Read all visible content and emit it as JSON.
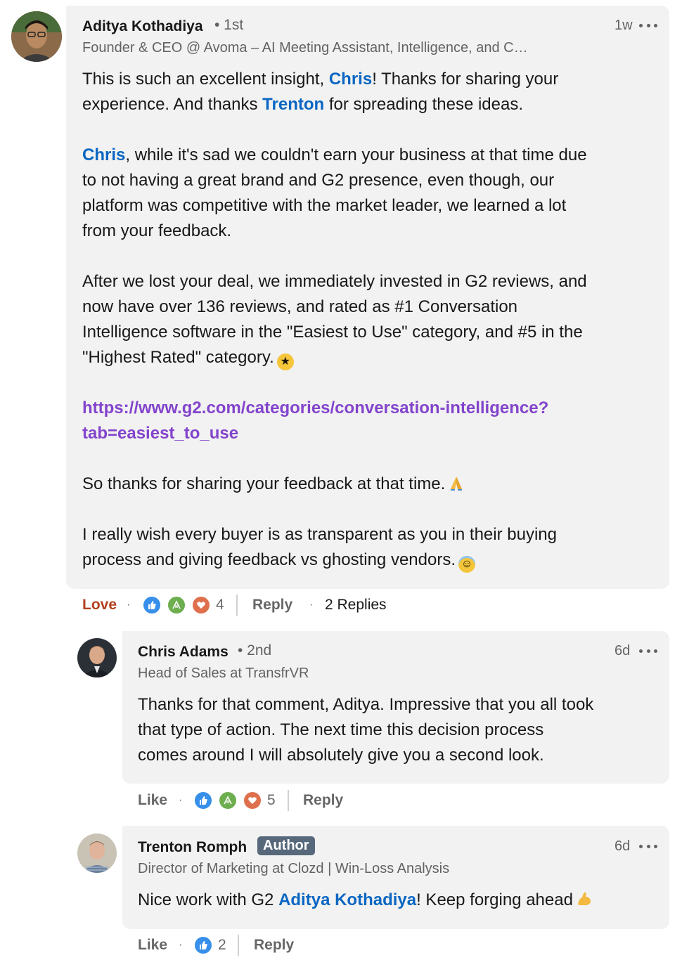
{
  "comments": [
    {
      "author": "Aditya Kothadiya",
      "degree": "• 1st",
      "headline": "Founder & CEO @ Avoma – AI Meeting Assistant, Intelligence, and C…",
      "time": "1w",
      "p1": [
        "This is such an excellent insight, ",
        "Chris",
        "! Thanks for sharing your",
        "experience. And thanks ",
        "Trenton",
        " for spreading these ideas."
      ],
      "p2": [
        "Chris",
        ", while it's sad we couldn't earn your business at that time due",
        "to not having a great brand and G2 presence, even though, our",
        "platform was competitive with the market leader, we learned a lot",
        "from your feedback."
      ],
      "p3": [
        "After we lost your deal, we immediately invested in G2 reviews, and",
        "now have over 136 reviews, and rated as #1 Conversation",
        "Intelligence software in the \"Easiest to Use\" category, and #5 in the",
        "\"Highest Rated\" category."
      ],
      "link": [
        "https://www.g2.com/categories/conversation-intelligence?",
        "tab=easiest_to_use"
      ],
      "p4": "So thanks for sharing your feedback at that time.",
      "p5": [
        "I really wish every buyer is as transparent as you in their buying",
        "process and giving feedback vs ghosting vendors."
      ],
      "reaction_label": "Love",
      "reaction_count": "4",
      "reply_label": "Reply",
      "replies_label": "2 Replies"
    }
  ],
  "replies": [
    {
      "author": "Chris Adams",
      "degree": "• 2nd",
      "headline": "Head of Sales at TransfrVR",
      "time": "6d",
      "lines": [
        "Thanks for that comment, Aditya. Impressive that you all took",
        "that type of action. The next time this decision process",
        "comes around I will absolutely give you a second look."
      ],
      "like_label": "Like",
      "reaction_count": "5",
      "reply_label": "Reply"
    },
    {
      "author": "Trenton Romph",
      "badge": "Author",
      "headline": "Director of Marketing at Clozd | Win-Loss Analysis",
      "time": "6d",
      "text_parts": [
        "Nice work with G2 ",
        "Aditya Kothadiya",
        "! Keep forging ahead"
      ],
      "like_label": "Like",
      "reaction_count": "2",
      "reply_label": "Reply"
    }
  ],
  "colors": {
    "bubble_bg": "#f2f2f2",
    "mention": "#0a66c2",
    "link": "#8344cc",
    "love_active": "#b24020",
    "author_badge": "#56687a"
  },
  "icons": {
    "like": "like-reaction-icon",
    "celebrate": "celebrate-reaction-icon",
    "love": "love-reaction-icon",
    "more": "more-options-icon",
    "star_struck": "star-struck-emoji-icon",
    "pray": "folded-hands-emoji-icon",
    "halo": "smiling-halo-emoji-icon",
    "flex": "flexed-biceps-emoji-icon"
  }
}
